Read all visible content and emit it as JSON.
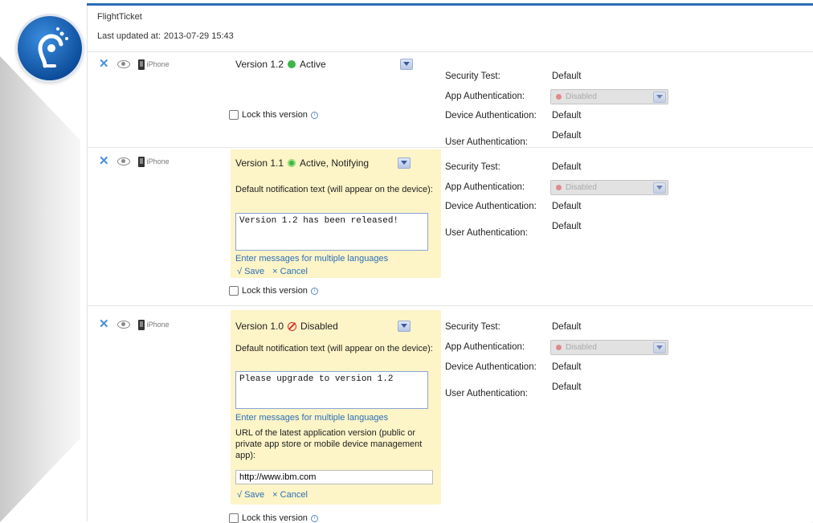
{
  "app": {
    "name": "FlightTicket",
    "last_updated_label": "Last updated at:",
    "last_updated_value": "2013-07-29 15:43"
  },
  "colors": {
    "topbar": "#2b6bb3",
    "link": "#2a6fb9",
    "notify_bg": "#fdf4c7",
    "active": "#3cb649",
    "disabled": "#d92b2b"
  },
  "versions": [
    {
      "platform": "iPhone",
      "version": "Version 1.2",
      "status": "Active",
      "lock_label": "Lock this version",
      "security": {
        "security_test_label": "Security Test:",
        "security_test_value": "Default",
        "app_auth_label": "App Authentication:",
        "app_auth_value": "Disabled",
        "device_auth_label": "Device Authentication:",
        "device_auth_value": "Default",
        "user_auth_label": "User Authentication:",
        "user_auth_value": "Default"
      }
    },
    {
      "platform": "iPhone",
      "version": "Version 1.1",
      "status": "Active, Notifying",
      "notif_label": "Default notification text (will appear on the device):",
      "notif_text": "Version 1.2 has been released!",
      "multi_lang": "Enter messages for multiple languages",
      "save": "√ Save",
      "cancel": "× Cancel",
      "lock_label": "Lock this version",
      "security": {
        "security_test_label": "Security Test:",
        "security_test_value": "Default",
        "app_auth_label": "App Authentication:",
        "app_auth_value": "Disabled",
        "device_auth_label": "Device Authentication:",
        "device_auth_value": "Default",
        "user_auth_label": "User Authentication:",
        "user_auth_value": "Default"
      }
    },
    {
      "platform": "iPhone",
      "version": "Version 1.0",
      "status": "Disabled",
      "notif_label": "Default notification text (will appear on the device):",
      "notif_text": "Please upgrade to version 1.2",
      "multi_lang": "Enter messages for multiple languages",
      "url_label": "URL of the latest application version (public or private app store or mobile device management app):",
      "url_value": "http://www.ibm.com",
      "save": "√ Save",
      "cancel": "× Cancel",
      "lock_label": "Lock this version",
      "security": {
        "security_test_label": "Security Test:",
        "security_test_value": "Default",
        "app_auth_label": "App Authentication:",
        "app_auth_value": "Disabled",
        "device_auth_label": "Device Authentication:",
        "device_auth_value": "Default",
        "user_auth_label": "User Authentication:",
        "user_auth_value": "Default"
      }
    }
  ]
}
